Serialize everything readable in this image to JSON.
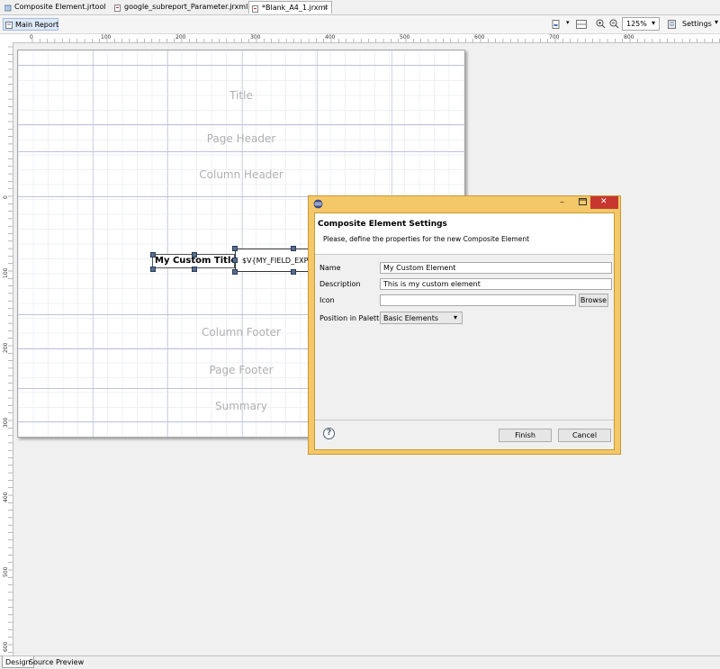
{
  "editor_tabs": [
    {
      "label": "Composite Element.jrtool",
      "active": false
    },
    {
      "label": "google_subreport_Parameter.jrxml",
      "active": false
    },
    {
      "label": "*Blank_A4_1.jrxml",
      "active": true
    }
  ],
  "toolbar": {
    "main_report_label": "Main Report",
    "zoom_value": "125%",
    "settings_label": "Settings"
  },
  "ruler": {
    "h_labels": [
      "0",
      "100",
      "200",
      "300",
      "400",
      "500",
      "600",
      "700",
      "800"
    ],
    "v_labels": [
      "0",
      "100",
      "200",
      "300",
      "400",
      "500",
      "600"
    ]
  },
  "report": {
    "bands": {
      "title": "Title",
      "page_header": "Page Header",
      "column_header": "Column Header",
      "column_footer": "Column Footer",
      "page_footer": "Page Footer",
      "summary": "Summary"
    },
    "static_text": "My Custom Title",
    "text_field": "$V{MY_FIELD_EXP"
  },
  "dialog": {
    "title": "Composite Element Settings",
    "subtitle": "Please, define the properties for the new Composite Element",
    "name_label": "Name",
    "name_value": "My Custom Element",
    "description_label": "Description",
    "description_value": "This is my custom element",
    "icon_label": "Icon",
    "icon_value": "",
    "browse_label": "Browse",
    "palette_label": "Position in Palette",
    "palette_value": "Basic Elements",
    "finish_label": "Finish",
    "cancel_label": "Cancel",
    "help_symbol": "?",
    "accent": "#f4c869",
    "close_color": "#c7372f"
  },
  "bottom_tabs": [
    {
      "label": "Design",
      "active": true
    },
    {
      "label": "Source",
      "active": false
    },
    {
      "label": "Preview",
      "active": false
    }
  ]
}
